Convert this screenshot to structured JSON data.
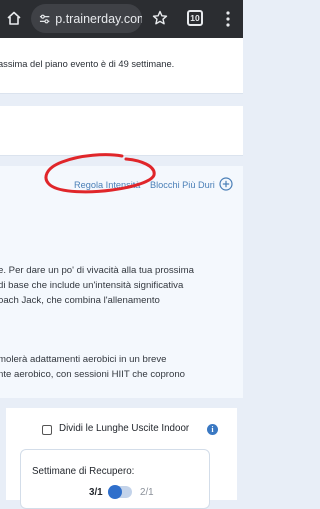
{
  "browser": {
    "url": "p.trainerday.com",
    "tab_count": "10"
  },
  "plan_notice": {
    "text": "assima del piano evento è di 49 settimane."
  },
  "blocks": {
    "adjust_intensity_link": "Regola Intensità",
    "harder_blocks_link": "Blocchi Più Duri"
  },
  "description": {
    "paragraph1": [
      "e. Per dare un po' di vivacità alla tua prossima",
      "di base che include un'intensità significativa",
      "oach Jack, che combina l'allenamento"
    ],
    "paragraph2": [
      "molerà adattamenti aerobici in un breve",
      "nte aerobico, con sessioni HIIT che coprono"
    ]
  },
  "options": {
    "split_long_rides_label": "Dividi le Lunghe Uscite Indoor",
    "split_long_rides_checked": false,
    "info_icon_text": "i",
    "recovery_weeks_label": "Settimane di Recupero:",
    "recovery_ratio_left": "3/1",
    "recovery_ratio_right": "2/1"
  },
  "colors": {
    "link": "#4a7fb7",
    "annotation_red": "#e0262a",
    "toggle_accent": "#2f6fcb"
  }
}
